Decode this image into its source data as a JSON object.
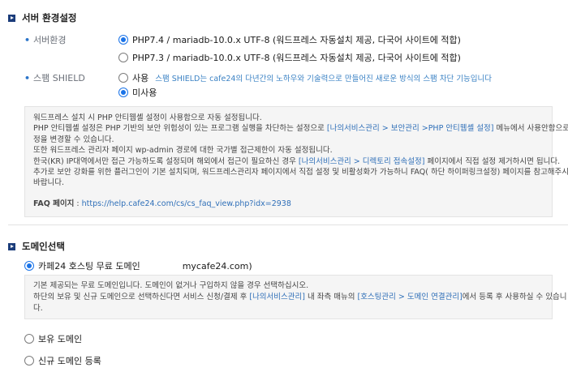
{
  "server": {
    "title": "서버 환경설정",
    "env_label": "서버환경",
    "env_options": [
      {
        "label": "PHP7.4 / mariadb-10.0.x UTF-8 (워드프레스 자동설치 제공, 다국어 사이트에 적합)",
        "selected": true
      },
      {
        "label": "PHP7.3 / mariadb-10.0.x UTF-8 (워드프레스 자동설치 제공, 다국어 사이트에 적합)",
        "selected": false
      }
    ],
    "shield_label": "스팸 SHIELD",
    "shield_use": "사용",
    "shield_hint": "스팸 SHIELD는 cafe24의 다년간의 노하우와 기술력으로 만들어진 새로운 방식의 스팸 차단 기능입니다",
    "shield_unuse": "미사용",
    "shield_use_selected": false,
    "shield_unuse_selected": true
  },
  "info": {
    "line1": "워드프레스 설치 시 PHP 안티웹셸 설정이 사용함으로 자동 설정됩니다.",
    "line2a": "PHP 안티웹셸 설정은 PHP 기반의 보안 위험성이 있는 프로그램 실행을 차단하는 설정으로 ",
    "line2_link": "[나의서비스관리 > 보안관리 >PHP 안티웹셸 설정]",
    "line2b": " 메뉴에서 사용안함으로 설",
    "line3": "정을 변경할 수 있습니다.",
    "line4": "또한 워드프레스 관리자 페이지 wp-admin 경로에 대한 국가별 접근제한이 자동 설정됩니다.",
    "line5a": "한국(KR) IP대역에서만 접근 가능하도록 설정되며 해외에서 접근이 필요하신 경우 ",
    "line5_link": "[나의서비스관리 > 디렉토리 접속설정]",
    "line5b": " 페이지에서 직접 설정 제거하시면 됩니다.",
    "line6": "추가로 보안 강화를 위한 플러그인이 기본 설치되며, 워드프레스관리자 페이지에서 직접 설정 및 비활성화가 가능하니 FAQ( 하단 하이퍼링크설정) 페이지를 참고해주시기",
    "line7": "바랍니다.",
    "faq_label": "FAQ 페이지",
    "faq_sep": " : ",
    "faq_url": "https://help.cafe24.com/cs/cs_faq_view.php?idx=2938"
  },
  "domain": {
    "title": "도메인선택",
    "free_label": "카페24 호스팅 무료 도메인",
    "free_domain": "mycafe24.com)",
    "free_selected": true,
    "note_line1": "기본 제공되는 무료 도메인입니다. 도메인이 없거나 구입하지 않을 경우 선택하십시오.",
    "note_line2a": "하단의 보유 및 신규 도메인으로 선택하신다면 서비스 신청/결제 후 ",
    "note_line2_link1": "[나의서비스관리]",
    "note_line2b": " 내 좌측 매뉴의 ",
    "note_line2_link2": "[호스팅관리 > 도메인 연결관리]",
    "note_line2c": "에서 등록 후 사용하실 수 있습니",
    "note_line3": "다.",
    "owned_label": "보유 도메인",
    "new_label": "신규 도메인 등록"
  }
}
